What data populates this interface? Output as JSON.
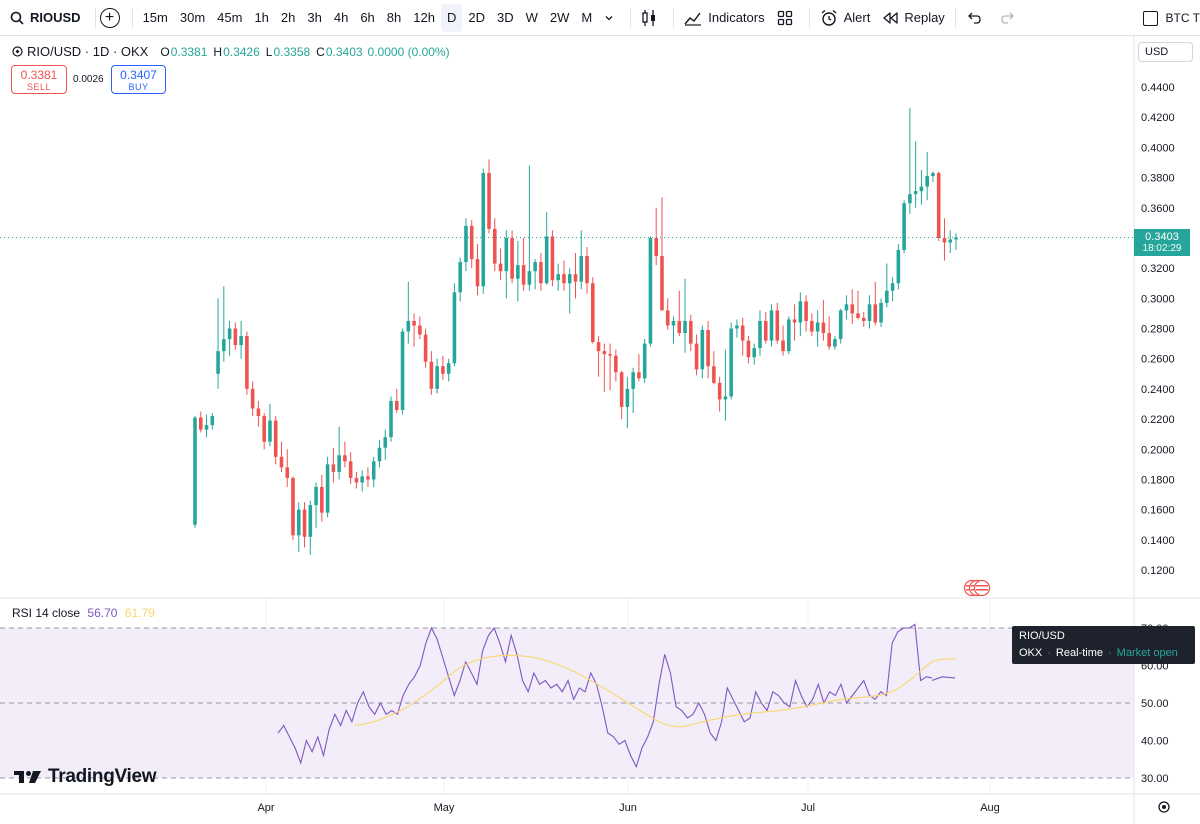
{
  "toolbar": {
    "symbol": "RIOUSD",
    "intervals": [
      "15m",
      "30m",
      "45m",
      "1h",
      "2h",
      "3h",
      "4h",
      "6h",
      "8h",
      "12h",
      "D",
      "2D",
      "3D",
      "W",
      "2W",
      "M"
    ],
    "active_interval": "D",
    "indicators_label": "Indicators",
    "alert_label": "Alert",
    "replay_label": "Replay",
    "compare_label": "BTC T"
  },
  "legend": {
    "title": "RIO/USD · 1D · OKX",
    "o_label": "O",
    "o": "0.3381",
    "h_label": "H",
    "h": "0.3426",
    "l_label": "L",
    "l": "0.3358",
    "c_label": "C",
    "c": "0.3403",
    "change": "0.0000 (0.00%)"
  },
  "trade": {
    "sell_price": "0.3381",
    "sell_label": "SELL",
    "spread": "0.0026",
    "buy_price": "0.3407",
    "buy_label": "BUY"
  },
  "currency": "USD",
  "last_price": {
    "value": "0.3403",
    "countdown": "18:02:29"
  },
  "rsi_legend": {
    "name": "RSI 14 close",
    "value": "56.70",
    "ma": "61.79"
  },
  "tooltip": {
    "symbol": "RIO/USD",
    "exchange": "OKX",
    "mode": "Real-time",
    "status": "Market open"
  },
  "brand": "TradingView",
  "colors": {
    "up": "#26a69a",
    "down": "#ef5350",
    "rsi": "#7e57c2",
    "rsi_ma": "#f9d76c",
    "rsi_band": "#ede7f6"
  },
  "chart_data": [
    {
      "type": "candlestick",
      "title": "RIO/USD · 1D · OKX",
      "x_ticks": [
        "Apr",
        "May",
        "Jun",
        "Jul",
        "Aug"
      ],
      "y_ticks": [
        "0.1200",
        "0.1400",
        "0.1600",
        "0.1800",
        "0.2000",
        "0.2200",
        "0.2400",
        "0.2600",
        "0.2800",
        "0.3000",
        "0.3200",
        "0.3400",
        "0.3600",
        "0.3800",
        "0.4000",
        "0.4200",
        "0.4400"
      ],
      "ylim": [
        0.11,
        0.445
      ],
      "start_date": "2024-03-19",
      "last_close": 0.3403,
      "ohlc": [
        [
          0.15,
          0.222,
          0.148,
          0.221
        ],
        [
          0.221,
          0.225,
          0.211,
          0.213
        ],
        [
          0.213,
          0.223,
          0.208,
          0.216
        ],
        [
          0.216,
          0.224,
          0.213,
          0.222
        ],
        [
          0.25,
          0.3,
          0.24,
          0.265
        ],
        [
          0.265,
          0.308,
          0.258,
          0.273
        ],
        [
          0.273,
          0.285,
          0.262,
          0.28
        ],
        [
          0.28,
          0.284,
          0.266,
          0.269
        ],
        [
          0.269,
          0.285,
          0.26,
          0.275
        ],
        [
          0.275,
          0.278,
          0.236,
          0.24
        ],
        [
          0.24,
          0.245,
          0.222,
          0.227
        ],
        [
          0.227,
          0.232,
          0.215,
          0.222
        ],
        [
          0.222,
          0.224,
          0.2,
          0.205
        ],
        [
          0.205,
          0.23,
          0.202,
          0.219
        ],
        [
          0.219,
          0.222,
          0.19,
          0.195
        ],
        [
          0.195,
          0.205,
          0.185,
          0.188
        ],
        [
          0.188,
          0.2,
          0.175,
          0.181
        ],
        [
          0.181,
          0.182,
          0.14,
          0.143
        ],
        [
          0.143,
          0.165,
          0.132,
          0.16
        ],
        [
          0.16,
          0.165,
          0.135,
          0.142
        ],
        [
          0.142,
          0.166,
          0.13,
          0.163
        ],
        [
          0.163,
          0.178,
          0.148,
          0.175
        ],
        [
          0.175,
          0.183,
          0.152,
          0.158
        ],
        [
          0.158,
          0.195,
          0.155,
          0.19
        ],
        [
          0.19,
          0.201,
          0.178,
          0.185
        ],
        [
          0.185,
          0.215,
          0.18,
          0.196
        ],
        [
          0.196,
          0.205,
          0.188,
          0.192
        ],
        [
          0.192,
          0.198,
          0.177,
          0.181
        ],
        [
          0.181,
          0.185,
          0.174,
          0.178
        ],
        [
          0.178,
          0.186,
          0.172,
          0.182
        ],
        [
          0.182,
          0.188,
          0.175,
          0.18
        ],
        [
          0.18,
          0.195,
          0.175,
          0.192
        ],
        [
          0.192,
          0.206,
          0.188,
          0.201
        ],
        [
          0.201,
          0.213,
          0.193,
          0.208
        ],
        [
          0.208,
          0.235,
          0.205,
          0.232
        ],
        [
          0.232,
          0.24,
          0.224,
          0.226
        ],
        [
          0.226,
          0.28,
          0.223,
          0.278
        ],
        [
          0.278,
          0.311,
          0.27,
          0.285
        ],
        [
          0.285,
          0.29,
          0.268,
          0.282
        ],
        [
          0.282,
          0.288,
          0.273,
          0.276
        ],
        [
          0.276,
          0.28,
          0.254,
          0.258
        ],
        [
          0.258,
          0.265,
          0.236,
          0.24
        ],
        [
          0.24,
          0.26,
          0.237,
          0.255
        ],
        [
          0.255,
          0.262,
          0.246,
          0.25
        ],
        [
          0.25,
          0.26,
          0.245,
          0.257
        ],
        [
          0.257,
          0.31,
          0.255,
          0.304
        ],
        [
          0.304,
          0.327,
          0.298,
          0.324
        ],
        [
          0.324,
          0.353,
          0.318,
          0.348
        ],
        [
          0.348,
          0.352,
          0.32,
          0.326
        ],
        [
          0.326,
          0.336,
          0.302,
          0.308
        ],
        [
          0.308,
          0.386,
          0.303,
          0.383
        ],
        [
          0.383,
          0.392,
          0.343,
          0.346
        ],
        [
          0.346,
          0.353,
          0.318,
          0.323
        ],
        [
          0.323,
          0.333,
          0.312,
          0.318
        ],
        [
          0.318,
          0.345,
          0.3,
          0.34
        ],
        [
          0.34,
          0.345,
          0.31,
          0.313
        ],
        [
          0.313,
          0.338,
          0.298,
          0.322
        ],
        [
          0.322,
          0.34,
          0.305,
          0.309
        ],
        [
          0.309,
          0.388,
          0.305,
          0.318
        ],
        [
          0.318,
          0.326,
          0.306,
          0.324
        ],
        [
          0.324,
          0.33,
          0.305,
          0.31
        ],
        [
          0.31,
          0.357,
          0.309,
          0.341
        ],
        [
          0.341,
          0.345,
          0.308,
          0.312
        ],
        [
          0.312,
          0.323,
          0.305,
          0.316
        ],
        [
          0.316,
          0.325,
          0.305,
          0.31
        ],
        [
          0.31,
          0.32,
          0.29,
          0.316
        ],
        [
          0.316,
          0.33,
          0.3,
          0.311
        ],
        [
          0.311,
          0.345,
          0.306,
          0.328
        ],
        [
          0.328,
          0.334,
          0.303,
          0.31
        ],
        [
          0.31,
          0.314,
          0.27,
          0.271
        ],
        [
          0.271,
          0.275,
          0.248,
          0.265
        ],
        [
          0.265,
          0.27,
          0.238,
          0.263
        ],
        [
          0.263,
          0.27,
          0.239,
          0.262
        ],
        [
          0.262,
          0.266,
          0.245,
          0.251
        ],
        [
          0.251,
          0.252,
          0.22,
          0.228
        ],
        [
          0.228,
          0.248,
          0.214,
          0.24
        ],
        [
          0.24,
          0.254,
          0.224,
          0.251
        ],
        [
          0.251,
          0.263,
          0.245,
          0.247
        ],
        [
          0.247,
          0.273,
          0.244,
          0.27
        ],
        [
          0.27,
          0.341,
          0.268,
          0.34
        ],
        [
          0.34,
          0.36,
          0.322,
          0.328
        ],
        [
          0.328,
          0.367,
          0.292,
          0.292
        ],
        [
          0.292,
          0.3,
          0.279,
          0.282
        ],
        [
          0.282,
          0.288,
          0.27,
          0.285
        ],
        [
          0.285,
          0.305,
          0.275,
          0.277
        ],
        [
          0.277,
          0.313,
          0.264,
          0.285
        ],
        [
          0.285,
          0.289,
          0.265,
          0.27
        ],
        [
          0.27,
          0.276,
          0.249,
          0.253
        ],
        [
          0.253,
          0.282,
          0.247,
          0.279
        ],
        [
          0.279,
          0.285,
          0.247,
          0.255
        ],
        [
          0.255,
          0.265,
          0.243,
          0.244
        ],
        [
          0.244,
          0.248,
          0.225,
          0.233
        ],
        [
          0.233,
          0.266,
          0.219,
          0.235
        ],
        [
          0.235,
          0.284,
          0.233,
          0.28
        ],
        [
          0.28,
          0.286,
          0.274,
          0.282
        ],
        [
          0.282,
          0.287,
          0.262,
          0.272
        ],
        [
          0.272,
          0.275,
          0.257,
          0.261
        ],
        [
          0.261,
          0.27,
          0.256,
          0.267
        ],
        [
          0.267,
          0.292,
          0.262,
          0.285
        ],
        [
          0.285,
          0.291,
          0.27,
          0.272
        ],
        [
          0.272,
          0.296,
          0.268,
          0.292
        ],
        [
          0.292,
          0.297,
          0.27,
          0.272
        ],
        [
          0.272,
          0.282,
          0.262,
          0.265
        ],
        [
          0.265,
          0.288,
          0.263,
          0.286
        ],
        [
          0.286,
          0.296,
          0.272,
          0.284
        ],
        [
          0.284,
          0.304,
          0.275,
          0.298
        ],
        [
          0.298,
          0.302,
          0.278,
          0.285
        ],
        [
          0.285,
          0.29,
          0.275,
          0.278
        ],
        [
          0.278,
          0.292,
          0.268,
          0.284
        ],
        [
          0.284,
          0.299,
          0.272,
          0.277
        ],
        [
          0.277,
          0.288,
          0.266,
          0.268
        ],
        [
          0.268,
          0.275,
          0.266,
          0.273
        ],
        [
          0.273,
          0.293,
          0.27,
          0.292
        ],
        [
          0.292,
          0.302,
          0.286,
          0.296
        ],
        [
          0.296,
          0.306,
          0.283,
          0.29
        ],
        [
          0.29,
          0.305,
          0.286,
          0.287
        ],
        [
          0.287,
          0.291,
          0.281,
          0.285
        ],
        [
          0.285,
          0.302,
          0.28,
          0.296
        ],
        [
          0.296,
          0.311,
          0.282,
          0.284
        ],
        [
          0.284,
          0.3,
          0.281,
          0.297
        ],
        [
          0.297,
          0.323,
          0.294,
          0.305
        ],
        [
          0.305,
          0.314,
          0.298,
          0.31
        ],
        [
          0.31,
          0.336,
          0.306,
          0.332
        ],
        [
          0.332,
          0.365,
          0.33,
          0.363
        ],
        [
          0.363,
          0.426,
          0.356,
          0.369
        ],
        [
          0.369,
          0.404,
          0.36,
          0.371
        ],
        [
          0.371,
          0.385,
          0.362,
          0.374
        ],
        [
          0.374,
          0.397,
          0.365,
          0.381
        ],
        [
          0.381,
          0.384,
          0.377,
          0.383
        ],
        [
          0.383,
          0.384,
          0.338,
          0.34
        ],
        [
          0.34,
          0.353,
          0.325,
          0.337
        ],
        [
          0.337,
          0.345,
          0.33,
          0.339
        ],
        [
          0.339,
          0.343,
          0.332,
          0.3403
        ]
      ]
    },
    {
      "type": "line",
      "title": "RSI 14 close",
      "y_ticks": [
        "30.00",
        "40.00",
        "50.00",
        "60.00",
        "70.00"
      ],
      "ylim": [
        28,
        71
      ],
      "bands": [
        30,
        50,
        70
      ],
      "series": [
        {
          "name": "RSI",
          "values": [
            42,
            44,
            41,
            38,
            34,
            40,
            37,
            41,
            36,
            43,
            47,
            44,
            48,
            45,
            50,
            53,
            49,
            47,
            50,
            47,
            48,
            47,
            52,
            55,
            57,
            60,
            66,
            70,
            67,
            62,
            57,
            52,
            56,
            61,
            58,
            55,
            64,
            68,
            70,
            66,
            61,
            68,
            63,
            56,
            53,
            58,
            55,
            56,
            54,
            55,
            53,
            56,
            51,
            54,
            53,
            58,
            55,
            49,
            42,
            41,
            39,
            40,
            36,
            33,
            38,
            41,
            45,
            55,
            63,
            58,
            49,
            48,
            46,
            47,
            50,
            47,
            42,
            40,
            45,
            54,
            51,
            48,
            45,
            46,
            53,
            50,
            48,
            53,
            52,
            50,
            49,
            56,
            52,
            49,
            51,
            55,
            50,
            53,
            52,
            55,
            50,
            52,
            54,
            56,
            52,
            51,
            53,
            52,
            66,
            69,
            70,
            70,
            71,
            56,
            57,
            56.7
          ]
        },
        {
          "name": "RSI-based MA",
          "values": [
            44,
            44.3,
            44.7,
            45.3,
            46.1,
            47,
            47.9,
            49,
            50.3,
            51.7,
            53.1,
            54.6,
            56.3,
            58,
            59.4,
            60.5,
            61.3,
            61.9,
            62.3,
            62.6,
            62.7,
            62.7,
            62.6,
            62.4,
            62.1,
            61.6,
            61,
            60.3,
            59.5,
            58.6,
            57.6,
            56.5,
            55.4,
            54.2,
            53,
            51.8,
            50.5,
            49.3,
            48,
            46.8,
            45.6,
            44.6,
            43.9,
            43.6,
            43.8,
            44.3,
            44.8,
            45.3,
            45.7,
            46.1,
            46.5,
            46.8,
            47.1,
            47.3,
            47.5,
            47.7,
            47.9,
            48.1,
            48.4,
            48.7,
            49.1,
            49.5,
            49.9,
            50.3,
            50.7,
            51,
            51.2,
            51.4,
            51.6,
            51.8,
            52.1,
            52.6,
            53.4,
            54.6,
            56.1,
            57.8,
            59.6,
            61.1,
            61.6,
            61.8,
            61.79
          ]
        }
      ]
    }
  ]
}
